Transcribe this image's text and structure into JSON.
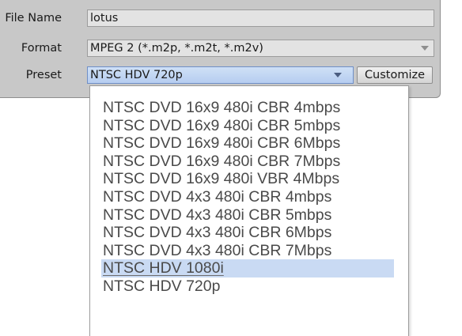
{
  "form": {
    "file_name_label": "File Name",
    "file_name_value": "lotus",
    "format_label": "Format",
    "format_value": "MPEG 2 (*.m2p, *.m2t, *.m2v)",
    "preset_label": "Preset",
    "preset_value": "NTSC HDV 720p",
    "customize_label": "Customize"
  },
  "preset_options": [
    "NTSC DVD 16x9 480i CBR 4mbps",
    "NTSC DVD 16x9 480i CBR 5mbps",
    "NTSC DVD 16x9 480i CBR 6Mbps",
    "NTSC DVD 16x9 480i CBR 7Mbps",
    "NTSC DVD 16x9 480i VBR 4Mbps",
    "NTSC DVD 4x3 480i CBR 4mbps",
    "NTSC DVD 4x3 480i CBR 5mbps",
    "NTSC DVD 4x3 480i CBR 6Mbps",
    "NTSC DVD 4x3 480i CBR 7Mbps",
    "NTSC HDV 1080i",
    "NTSC HDV 720p"
  ],
  "highlighted_option": "NTSC HDV 1080i",
  "colors": {
    "panel": "#c8c8c8",
    "highlight": "#c9daf3"
  }
}
